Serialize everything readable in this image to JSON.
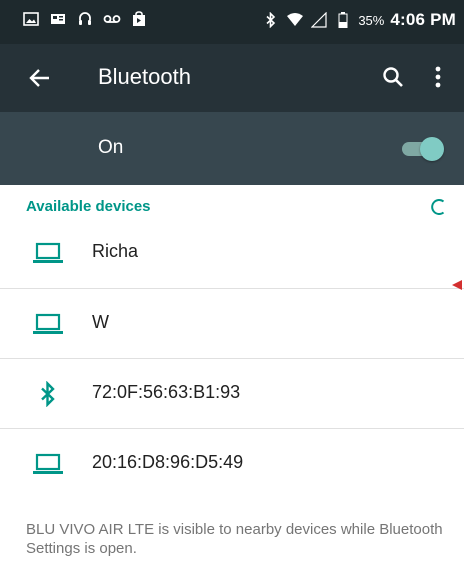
{
  "status_bar": {
    "battery_percent": "35%",
    "time": "4:06 PM",
    "icons": [
      "image-icon",
      "media-icon",
      "headset-icon",
      "voicemail-icon",
      "shopping-bag-icon",
      "bluetooth-icon",
      "wifi-icon",
      "signal-icon",
      "battery-icon"
    ]
  },
  "app_bar": {
    "title": "Bluetooth",
    "icons": [
      "back-arrow-icon",
      "search-icon",
      "more-vert-icon"
    ]
  },
  "toggle": {
    "label": "On",
    "checked": true
  },
  "section": {
    "title": "Available devices"
  },
  "devices": [
    {
      "name": "Richa",
      "icon": "laptop-icon"
    },
    {
      "name": "W",
      "icon": "laptop-icon"
    },
    {
      "name": "72:0F:56:63:B1:93",
      "icon": "bluetooth-icon"
    },
    {
      "name": "20:16:D8:96:D5:49",
      "icon": "laptop-icon"
    }
  ],
  "footer": {
    "text": "BLU VIVO AIR LTE is visible to nearby devices while Bluetooth Settings is open."
  },
  "colors": {
    "status_bar": "#1e292d",
    "app_bar": "#263238",
    "toggle_bar": "#37474f",
    "accent": "#009688",
    "switch_thumb": "#80cbc4",
    "marker": "#d32f2f"
  }
}
